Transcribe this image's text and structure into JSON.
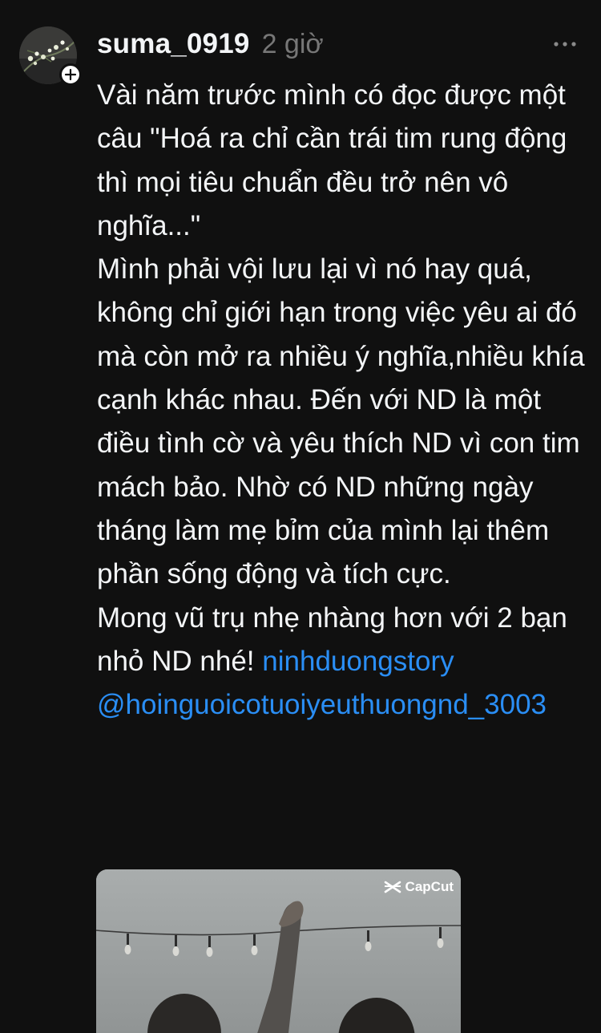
{
  "post": {
    "username": "suma_0919",
    "timestamp": "2 giờ",
    "paragraphs": [
      "Vài năm trước mình có đọc được một câu \"Hoá ra chỉ cần trái tim rung động thì mọi tiêu chuẩn đều trở nên vô nghĩa...\"",
      "Mình phải vội lưu lại vì nó hay quá, không chỉ giới hạn trong việc yêu ai đó mà còn mở ra nhiều ý nghĩa,nhiều khía cạnh khác nhau. Đến với ND là một điều tình cờ và yêu thích ND vì con tim mách bảo. Nhờ có ND những ngày tháng làm mẹ bỉm của mình lại thêm phần sống động và tích cực.",
      "Mong vũ trụ nhẹ nhàng hơn với 2 bạn nhỏ ND nhé!"
    ],
    "tag": "ninhduongstory",
    "mention": "@hoinguoicotuoiyeuthuongnd_3003",
    "media_watermark": "CapCut"
  },
  "icons": {
    "avatar": "avatar-flowers",
    "follow": "plus-icon",
    "more": "more-horizontal-icon",
    "watermark": "capcut-logo-icon"
  },
  "colors": {
    "background": "#101010",
    "text": "#f3f5f7",
    "timestamp": "#777777",
    "link": "#2a8ef5"
  }
}
